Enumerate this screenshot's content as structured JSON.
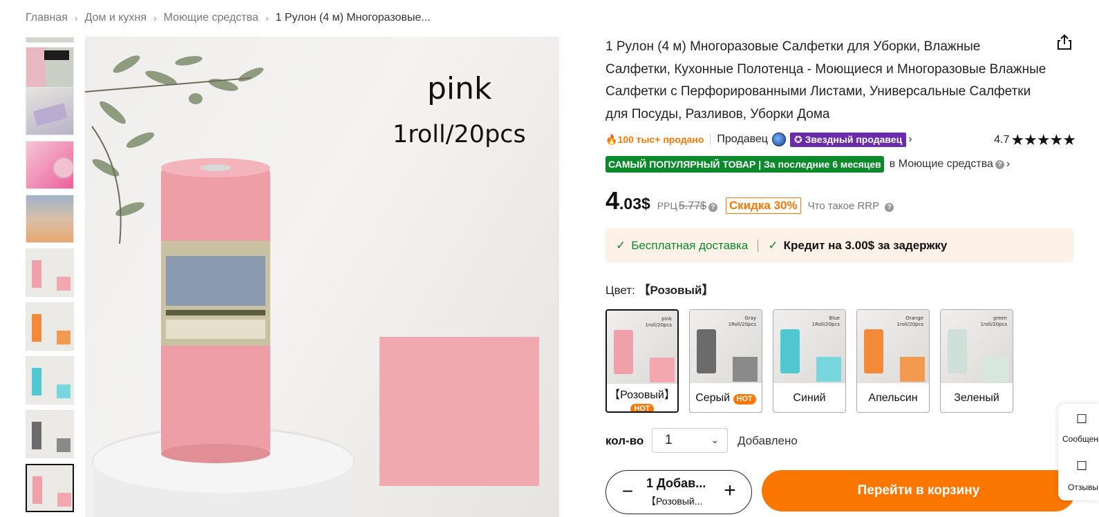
{
  "breadcrumb": {
    "items": [
      "Главная",
      "Дом и кухня",
      "Моющие средства"
    ],
    "current": "1 Рулон (4 м) Многоразовые..."
  },
  "gallery": {
    "main_image_text_color": "pink",
    "main_image_text_count": "1roll/20pcs",
    "thumb_count": 9,
    "active_index": 8
  },
  "product": {
    "title": "1 Рулон (4 м) Многоразовые Салфетки для Уборки, Влажные Салфетки, Кухонные Полотенца - Моющиеся и Многоразовые Влажные Салфетки с Перфорированными Листами, Универсальные Салфетки для Посуды, Разливов, Уборки Дома",
    "sold": "100 тыс+ продано",
    "seller_label": "Продавец",
    "star_seller": "Звездный продавец",
    "rating": "4.7",
    "stars": "★★★★★",
    "popular_badge": "САМЫЙ ПОПУЛЯРНЫЙ ТОВАР | За последние 6 месяцев",
    "popular_category": "в Моющие средства",
    "price_int": "4",
    "price_dec": ".03$",
    "rrp_label": "РРЦ",
    "rrp_value": "5.77$",
    "discount": "Скидка 30%",
    "what_rrp": "Что такое RRP"
  },
  "promo": {
    "free_shipping": "Бесплатная доставка",
    "credit": "Кредит на 3.00$ за задержку"
  },
  "colors": {
    "label": "Цвет:",
    "selected": "【Розовый】",
    "hot_label": "HOT",
    "options": [
      {
        "name": "【Розовый】",
        "hot": true,
        "roll": "#f0a0a8",
        "sq": "#f2a8ae",
        "tag1": "pink",
        "tag2": "1roll/20pcs"
      },
      {
        "name": "Серый",
        "hot": true,
        "roll": "#6b6b6b",
        "sq": "#8a8a8a",
        "tag1": "Gray",
        "tag2": "1Roll/20pcs"
      },
      {
        "name": "Синий",
        "hot": false,
        "roll": "#4fc8d2",
        "sq": "#78d6de",
        "tag1": "Blue",
        "tag2": "1Roll/20pcs"
      },
      {
        "name": "Апельсин",
        "hot": false,
        "roll": "#f28a3a",
        "sq": "#f29a50",
        "tag1": "Orange",
        "tag2": "1roll/20pcs"
      },
      {
        "name": "Зеленый",
        "hot": false,
        "roll": "#cfe0da",
        "sq": "#d8e6e0",
        "tag1": "green",
        "tag2": "1roll/20pcs"
      }
    ]
  },
  "quantity": {
    "label": "кол-во",
    "value": "1",
    "added": "Добавлено"
  },
  "cart": {
    "stepper_line1": "1 Добав...",
    "stepper_line2": "【Розовый...",
    "button": "Перейти в корзину"
  },
  "side_panel": {
    "messages": "Сообщения",
    "reviews": "Отзывы"
  },
  "colors_theme": {
    "accent": "#fb7701",
    "green": "#0a8a2a",
    "purple": "#6a2ca8"
  }
}
